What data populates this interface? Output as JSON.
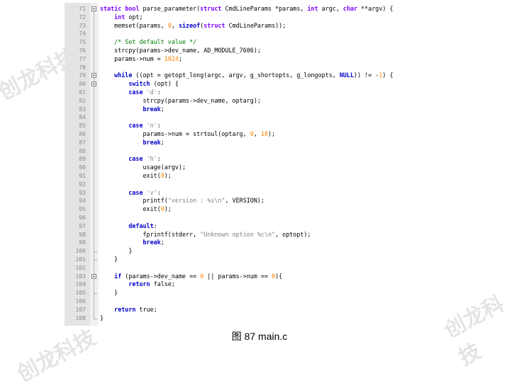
{
  "watermark": {
    "text": "创龙科技"
  },
  "caption": {
    "text": "图  87 main.c"
  },
  "code": {
    "lines": [
      {
        "ln": "71",
        "html": "<span class=\"type\">static</span> <span class=\"type\">bool</span> parse_parameter(<span class=\"type\">struct</span> CmdLineParams *params, <span class=\"type\">int</span> argc, <span class=\"type\">char</span> **argv) {"
      },
      {
        "ln": "72",
        "html": "    <span class=\"type\">int</span> opt;"
      },
      {
        "ln": "73",
        "html": "    memset(params, <span class=\"num\">0</span>, <span class=\"kw\">sizeof</span>(<span class=\"type\">struct</span> CmdLineParams));"
      },
      {
        "ln": "74",
        "html": ""
      },
      {
        "ln": "75",
        "html": "    <span class=\"com\">/* Set default value */</span>"
      },
      {
        "ln": "76",
        "html": "    strcpy(params->dev_name, AD_MODULE_7606);"
      },
      {
        "ln": "77",
        "html": "    params->num = <span class=\"num\">1024</span>;"
      },
      {
        "ln": "78",
        "html": ""
      },
      {
        "ln": "79",
        "html": "    <span class=\"kw\">while</span> ((opt = getopt_long(argc, argv, g_shortopts, g_longopts, <span class=\"kw\">NULL</span>)) != -<span class=\"num\">1</span>) {"
      },
      {
        "ln": "80",
        "html": "        <span class=\"kw\">switch</span> (opt) {"
      },
      {
        "ln": "81",
        "html": "        <span class=\"kw\">case</span> <span class=\"str\">'d'</span>:"
      },
      {
        "ln": "82",
        "html": "            strcpy(params->dev_name, optarg);"
      },
      {
        "ln": "83",
        "html": "            <span class=\"kw\">break</span>;"
      },
      {
        "ln": "84",
        "html": ""
      },
      {
        "ln": "85",
        "html": "        <span class=\"kw\">case</span> <span class=\"str\">'n'</span>:"
      },
      {
        "ln": "86",
        "html": "            params->num = strtoul(optarg, <span class=\"num\">0</span>, <span class=\"num\">10</span>);"
      },
      {
        "ln": "87",
        "html": "            <span class=\"kw\">break</span>;"
      },
      {
        "ln": "88",
        "html": ""
      },
      {
        "ln": "89",
        "html": "        <span class=\"kw\">case</span> <span class=\"str\">'h'</span>:"
      },
      {
        "ln": "90",
        "html": "            usage(argv);"
      },
      {
        "ln": "91",
        "html": "            exit(<span class=\"num\">0</span>);"
      },
      {
        "ln": "92",
        "html": ""
      },
      {
        "ln": "93",
        "html": "        <span class=\"kw\">case</span> <span class=\"str\">'v'</span>:"
      },
      {
        "ln": "94",
        "html": "            printf(<span class=\"str\">\"version : %s\\n\"</span>, VERSION);"
      },
      {
        "ln": "95",
        "html": "            exit(<span class=\"num\">0</span>);"
      },
      {
        "ln": "96",
        "html": ""
      },
      {
        "ln": "97",
        "html": "        <span class=\"kw\">default</span>:"
      },
      {
        "ln": "98",
        "html": "            fprintf(stderr, <span class=\"str\">\"Unknown option %c\\n\"</span>, optopt);"
      },
      {
        "ln": "99",
        "html": "            <span class=\"kw\">break</span>;"
      },
      {
        "ln": "100",
        "html": "        }"
      },
      {
        "ln": "101",
        "html": "    }"
      },
      {
        "ln": "102",
        "html": ""
      },
      {
        "ln": "103",
        "html": "    <span class=\"kw\">if</span> (params->dev_name == <span class=\"num\">0</span> || params->num == <span class=\"num\">0</span>){"
      },
      {
        "ln": "104",
        "html": "        <span class=\"kw\">return</span> false;"
      },
      {
        "ln": "105",
        "html": "    }"
      },
      {
        "ln": "106",
        "html": ""
      },
      {
        "ln": "107",
        "html": "    <span class=\"kw\">return</span> true;"
      },
      {
        "ln": "108",
        "html": "}"
      }
    ]
  }
}
